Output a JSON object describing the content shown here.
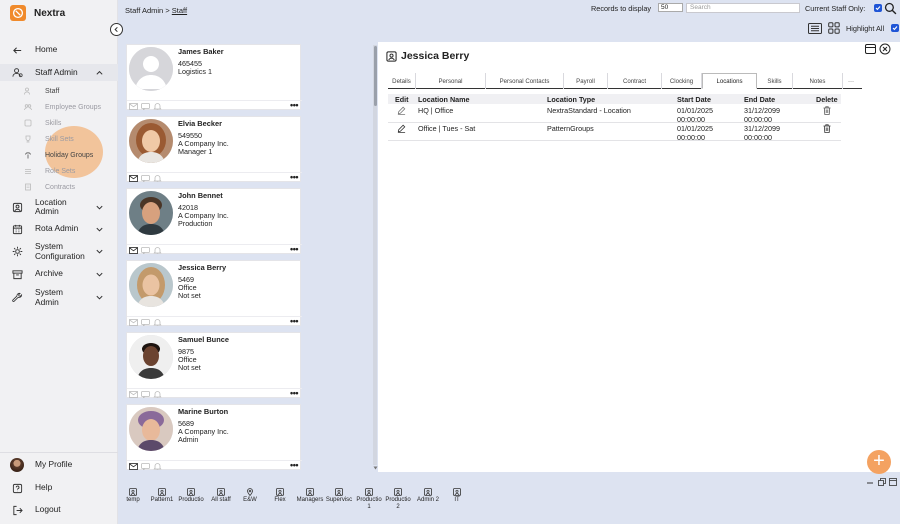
{
  "app": {
    "name": "Nextra"
  },
  "sidebar": {
    "items": [
      {
        "label": "Home"
      },
      {
        "label": "Staff Admin"
      },
      {
        "label": "Location Admin"
      },
      {
        "label": "Rota Admin"
      },
      {
        "label": "System Configuration"
      },
      {
        "label": "Archive"
      },
      {
        "label": "System Admin"
      }
    ],
    "subitems": [
      {
        "label": "Staff"
      },
      {
        "label": "Employee Groups"
      },
      {
        "label": "Skills"
      },
      {
        "label": "Skill Sets"
      },
      {
        "label": "Holiday Groups"
      },
      {
        "label": "Role Sets"
      },
      {
        "label": "Contracts"
      }
    ],
    "footer": [
      {
        "label": "My Profile"
      },
      {
        "label": "Help"
      },
      {
        "label": "Logout"
      }
    ]
  },
  "header": {
    "breadcrumb_parent": "Staff Admin",
    "breadcrumb_sep": ">",
    "breadcrumb_current": "Staff",
    "records_label": "Records to display",
    "records_value": "50",
    "search_placeholder": "Search",
    "current_staff_label": "Current Staff Only:",
    "highlight_label": "Highlight All"
  },
  "staff": [
    {
      "name": "James Baker",
      "id": "465455",
      "line2": "Logistics 1",
      "line3": ""
    },
    {
      "name": "Elvia Becker",
      "id": "549550",
      "line2": "A Company Inc.",
      "line3": "Manager 1"
    },
    {
      "name": "John Bennet",
      "id": "42018",
      "line2": "A Company Inc.",
      "line3": "Production"
    },
    {
      "name": "Jessica Berry",
      "id": "5469",
      "line2": "Office",
      "line3": "Not set"
    },
    {
      "name": "Samuel Bunce",
      "id": "9875",
      "line2": "Office",
      "line3": "Not set"
    },
    {
      "name": "Marine Burton",
      "id": "5689",
      "line2": "A Company Inc.",
      "line3": "Admin"
    }
  ],
  "detail": {
    "title": "Jessica Berry",
    "tabs": [
      "Details",
      "Personal",
      "Personal Contacts",
      "Payroll",
      "Contract",
      "Clocking",
      "Locations",
      "Skills",
      "Notes",
      "···"
    ],
    "active_tab": "Locations",
    "columns": [
      "Edit",
      "Location Name",
      "Location Type",
      "Start Date",
      "End Date",
      "Delete"
    ],
    "rows": [
      {
        "name": "HQ | Office",
        "type": "NextraStandard - Location",
        "start": "01/01/2025",
        "start_time": "00:00:00",
        "end": "31/12/2099",
        "end_time": "00:00:00"
      },
      {
        "name": "Office | Tues - Sat",
        "type": "PatternGroups",
        "start": "01/01/2025",
        "start_time": "00:00:00",
        "end": "31/12/2099",
        "end_time": "00:00:00"
      }
    ]
  },
  "bottom_tabs": [
    {
      "l1": "temp",
      "l2": ""
    },
    {
      "l1": "Pattern1",
      "l2": ""
    },
    {
      "l1": "Productio",
      "l2": ""
    },
    {
      "l1": "All staff",
      "l2": ""
    },
    {
      "l1": "E&W",
      "l2": ""
    },
    {
      "l1": "Flex",
      "l2": ""
    },
    {
      "l1": "Managers",
      "l2": ""
    },
    {
      "l1": "Supervisc",
      "l2": ""
    },
    {
      "l1": "Productio",
      "l2": "1"
    },
    {
      "l1": "Productio",
      "l2": "2"
    },
    {
      "l1": "Admin 2",
      "l2": ""
    },
    {
      "l1": "IT",
      "l2": ""
    }
  ],
  "fab_label": "+",
  "colors": {
    "accent": "#f08a2b",
    "checkbox": "#1f55d6",
    "background": "#dde3f1"
  }
}
